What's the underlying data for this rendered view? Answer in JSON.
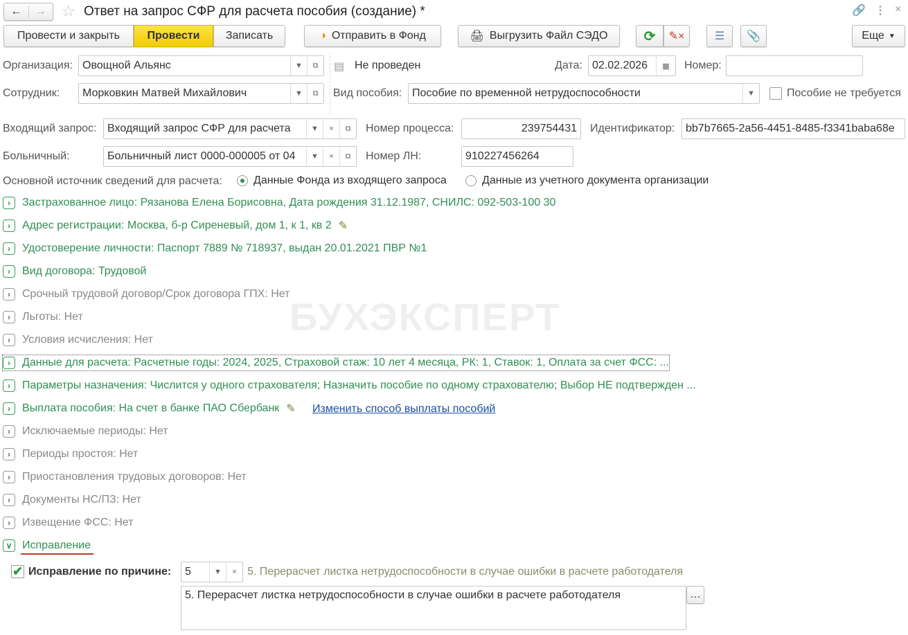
{
  "window": {
    "title": "Ответ на запрос СФР для расчета пособия (создание) *"
  },
  "toolbar": {
    "post_close": "Провести и закрыть",
    "post": "Провести",
    "save": "Записать",
    "send_fund": "Отправить в Фонд",
    "export_sedo": "Выгрузить Файл СЭДО",
    "more": "Еще"
  },
  "form": {
    "org_label": "Организация:",
    "org_value": "Овощной Альянс",
    "status": "Не проведен",
    "date_label": "Дата:",
    "date_value": "02.02.2026",
    "number_label": "Номер:",
    "number_value": "",
    "employee_label": "Сотрудник:",
    "employee_value": "Морковкин Матвей Михайлович",
    "benefit_type_label": "Вид пособия:",
    "benefit_type_value": "Пособие по временной нетрудоспособности",
    "benefit_not_required": "Пособие не требуется",
    "incoming_label": "Входящий запрос:",
    "incoming_value": "Входящий запрос СФР для расчета",
    "process_label": "Номер процесса:",
    "process_value": "239754431",
    "id_label": "Идентификатор:",
    "id_value": "bb7b7665-2a56-4451-8485-f3341baba68e",
    "sick_label": "Больничный:",
    "sick_value": "Больничный лист 0000-000005 от 04",
    "ln_label": "Номер ЛН:",
    "ln_value": "910227456264",
    "source_label": "Основной источник сведений для расчета:",
    "source_opt1": "Данные Фонда из входящего запроса",
    "source_opt2": "Данные из учетного документа организации"
  },
  "sections": [
    {
      "text": "Застрахованное лицо: Рязанова Елена Борисовна, Дата рождения 31.12.1987, СНИЛС: 092-503-100 30",
      "green": true
    },
    {
      "text": "Адрес регистрации: Москва, б-р Сиреневый, дом 1, к 1, кв 2",
      "green": true,
      "edit": true
    },
    {
      "text": "Удостоверение личности: Паспорт 7889 № 718937, выдан 20.01.2021 ПВР №1",
      "green": true
    },
    {
      "text": "Вид договора: Трудовой",
      "green": true
    },
    {
      "text": "Срочный трудовой договор/Срок договора ГПХ: Нет",
      "green": false
    },
    {
      "text": "Льготы: Нет",
      "green": false
    },
    {
      "text": "Условия исчисления: Нет",
      "green": false
    },
    {
      "text": "Данные для расчета: Расчетные годы: 2024, 2025, Страховой стаж: 10 лет 4 месяца, РК: 1, Ставок: 1, Оплата за счет ФСС: ...",
      "green": true
    },
    {
      "text": "Параметры назначения: Числится у одного страхователя; Назначить пособие по одному страхователю; Выбор НЕ подтвержден ...",
      "green": true
    },
    {
      "text": "Выплата пособия: На счет в банке ПАО Сбербанк",
      "green": true,
      "edit": true
    },
    {
      "text": "Исключаемые периоды: Нет",
      "green": false
    },
    {
      "text": "Периоды простоя: Нет",
      "green": false
    },
    {
      "text": "Приостановления трудовых договоров: Нет",
      "green": false
    },
    {
      "text": "Документы НС/ПЗ: Нет",
      "green": false
    },
    {
      "text": "Извещение ФСС: Нет",
      "green": false
    },
    {
      "text": "Исправление",
      "green": true,
      "expanded": true
    }
  ],
  "change_payment_link": "Изменить способ выплаты пособий",
  "correction": {
    "label": "Исправление по причине:",
    "code": "5",
    "description": "5. Перерасчет листка нетрудоспособности в случае ошибки в расчете работодателя",
    "text": "5. Перерасчет листка нетрудоспособности в случае ошибки в расчете работодателя",
    "checked": true
  },
  "watermark": "БУХЭКСПЕРТ",
  "colors": {
    "green": "#2f8f55",
    "yellow": "#f5d400",
    "link": "#1a4fa0"
  }
}
